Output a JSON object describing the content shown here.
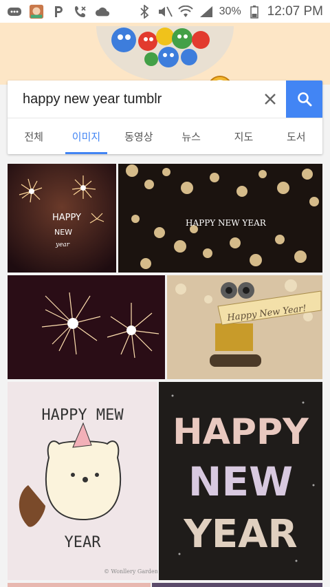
{
  "status_bar": {
    "battery": "30%",
    "time": "12:07 PM"
  },
  "search": {
    "query": "happy new year tumblr"
  },
  "tabs": [
    {
      "label": "전체"
    },
    {
      "label": "이미지"
    },
    {
      "label": "동영상"
    },
    {
      "label": "뉴스"
    },
    {
      "label": "지도"
    },
    {
      "label": "도서"
    }
  ],
  "images": [
    {
      "text": [
        "HAPPY",
        "NEW",
        "year"
      ]
    },
    {
      "text": [
        "HAPPY NEW YEAR"
      ]
    },
    {
      "text": []
    },
    {
      "text": [
        "Happy New Year!"
      ]
    },
    {
      "text": [
        "HAPPY MEW",
        "YEAR",
        "© Wonllery Garden"
      ]
    },
    {
      "text": [
        "HAPPY",
        "NEW",
        "YEAR"
      ]
    }
  ],
  "colors": {
    "accent": "#4285f4",
    "doodle_bg": "#fde6c6"
  }
}
